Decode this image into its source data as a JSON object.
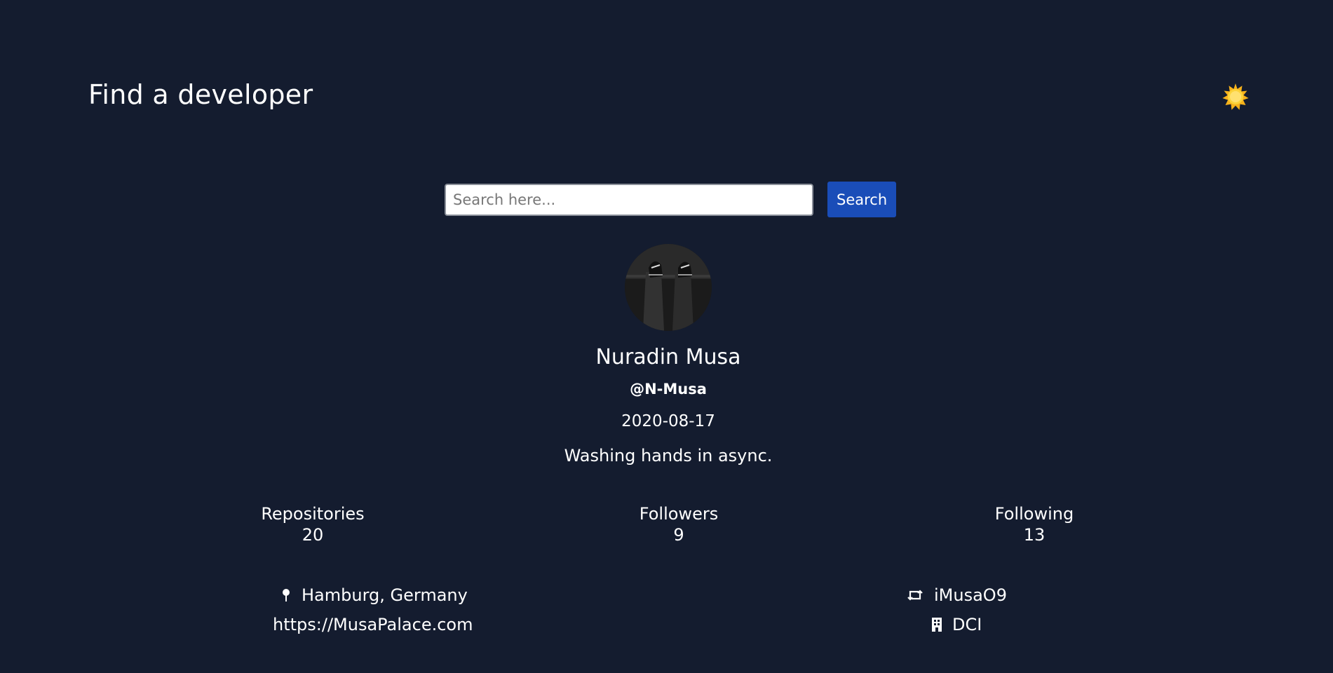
{
  "header": {
    "title": "Find a developer",
    "theme_toggle_icon": "sun-icon"
  },
  "search": {
    "placeholder": "Search here...",
    "value": "",
    "button_label": "Search"
  },
  "profile": {
    "avatar_icon": "avatar",
    "name": "Nuradin Musa",
    "login": "@N-Musa",
    "joined": "2020-08-17",
    "bio": "Washing hands in async."
  },
  "stats": {
    "repositories": {
      "label": "Repositories",
      "value": "20"
    },
    "followers": {
      "label": "Followers",
      "value": "9"
    },
    "following": {
      "label": "Following",
      "value": "13"
    }
  },
  "info": {
    "location": {
      "icon": "pin-icon",
      "text": "Hamburg, Germany"
    },
    "blog": {
      "text": "https://MusaPalace.com"
    },
    "twitter": {
      "icon": "retweet-icon",
      "text": "iMusaO9"
    },
    "company": {
      "icon": "building-icon",
      "text": "DCI"
    }
  },
  "colors": {
    "background": "#141c2f",
    "accent": "#1a4db8",
    "text": "#ffffff"
  }
}
